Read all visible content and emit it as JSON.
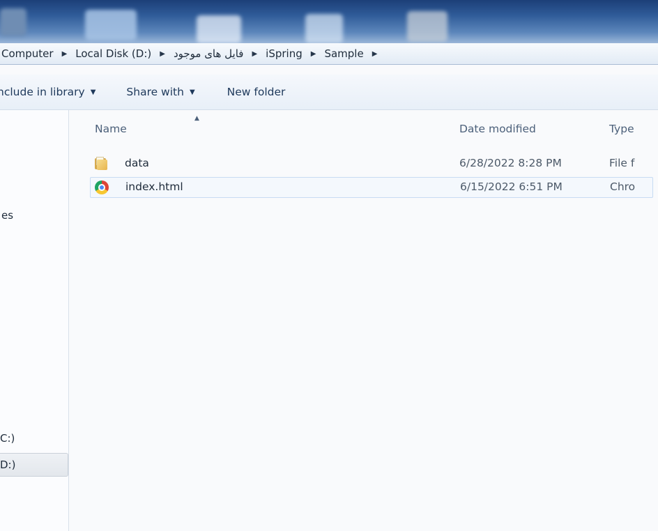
{
  "breadcrumb": {
    "items": [
      "Computer",
      "Local Disk (D:)",
      "فایل های موجود",
      "iSpring",
      "Sample"
    ],
    "separator": "▶"
  },
  "toolbar": {
    "include_in_library": "nclude in library",
    "share_with": "Share with",
    "new_folder": "New folder",
    "caret": "▼"
  },
  "nav": {
    "libraries_fragment": "es",
    "drive_c_fragment": "C:)",
    "drive_d_fragment": "D:)"
  },
  "columns": {
    "name": "Name",
    "date_modified": "Date modified",
    "type": "Type",
    "sort_indicator": "▲"
  },
  "files": [
    {
      "name": "data",
      "date": "6/28/2022 8:28 PM",
      "type": "File f",
      "icon": "folder-icon"
    },
    {
      "name": "index.html",
      "date": "6/15/2022 6:51 PM",
      "type": "Chro",
      "icon": "chrome-icon",
      "selected": true
    }
  ]
}
